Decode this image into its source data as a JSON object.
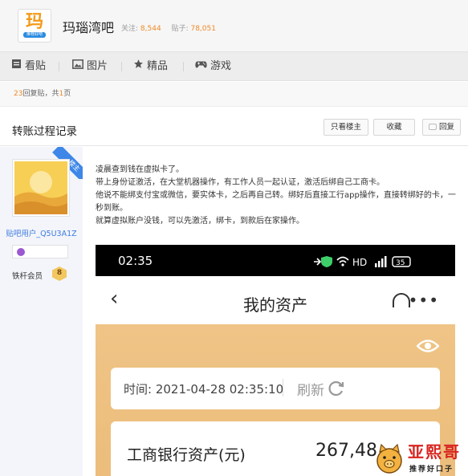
{
  "forum": {
    "logo_char": "玛",
    "logo_sub": "推荐好吧",
    "name": "玛瑙湾吧",
    "follow_label": "关注:",
    "follow_count": "8,544",
    "posts_label": "贴子:",
    "posts_count": "78,051"
  },
  "tabs": [
    {
      "label": "看贴",
      "icon": "document-icon"
    },
    {
      "label": "图片",
      "icon": "image-icon"
    },
    {
      "label": "精品",
      "icon": "star-icon"
    },
    {
      "label": "游戏",
      "icon": "gamepad-icon"
    }
  ],
  "reply_bar": {
    "count": "23",
    "count_suffix": "回复贴，共",
    "pages": "1",
    "pages_suffix": "页"
  },
  "thread": {
    "title": "转账过程记录",
    "only_op_label": "只看楼主",
    "collect_label": "收藏",
    "reply_label": "回复"
  },
  "author": {
    "badge": "楼主",
    "username": "贴吧用户_Q5U3A1Z",
    "member_label": "铁杆会员",
    "level": "8"
  },
  "post": {
    "lines": [
      "凌晨查到钱在虚拟卡了。",
      "带上身份证激活，在大堂机器操作，有工作人员一起认证，激活后绑自己工商卡。",
      "他说不能绑支付宝或微信，要实体卡，之后再自己转。绑好后直接工行app操作，直接转绑好的卡，一秒到账。",
      "就算虚拟账户没钱，可以先激活，绑卡，到款后在家操作。"
    ]
  },
  "screenshot": {
    "time": "02:35",
    "status_text": "HD",
    "battery": "35",
    "title": "我的资产",
    "record_time": "时间: 2021-04-28 02:35:10",
    "refresh_label": "刷新",
    "asset_label": "工商银行资产(元)",
    "asset_value": "267,48"
  },
  "watermark": {
    "text": "亚熙哥",
    "sub": "推荐好口子"
  },
  "colors": {
    "accent_orange": "#f08a26",
    "link_blue": "#3d7be0",
    "badge_blue": "#3e87e8",
    "card_gold": "#efc486",
    "watermark_red": "#d8241f"
  }
}
